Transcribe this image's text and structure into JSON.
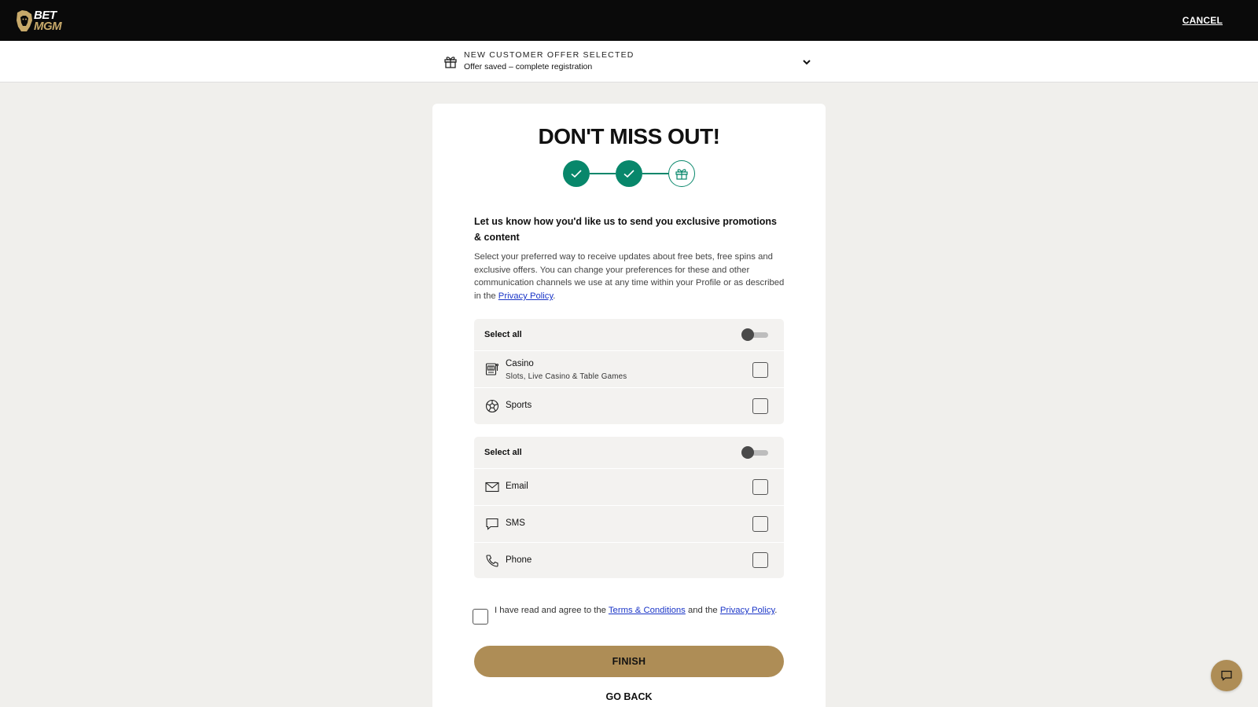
{
  "header": {
    "logo_line1": "BET",
    "logo_line2": "MGM",
    "cancel_label": "CANCEL"
  },
  "offer_bar": {
    "heading": "NEW CUSTOMER OFFER SELECTED",
    "subtext": "Offer saved – complete registration",
    "icon": "gift-icon",
    "expand_icon": "chevron-down-icon"
  },
  "card": {
    "title": "DON'T MISS OUT!",
    "stepper": {
      "steps": [
        {
          "state": "done",
          "icon": "check-icon"
        },
        {
          "state": "done",
          "icon": "check-icon"
        },
        {
          "state": "current",
          "icon": "gift-icon"
        }
      ],
      "active_color": "#08876b"
    },
    "lead": "Let us know how you'd like us to send you exclusive promotions & content",
    "description_before_link": "Select your preferred way to receive updates about free bets, free spins and exclusive offers. You can change your preferences for these and other communication channels we use at any time within your Profile or as described in the ",
    "description_link": "Privacy Policy",
    "description_after_link": ".",
    "products_group": {
      "select_all_label": "Select all",
      "select_all_on": false,
      "items": [
        {
          "label": "Casino",
          "sublabel": "Slots, Live Casino & Table Games",
          "icon": "slot-machine-icon",
          "checked": false
        },
        {
          "label": "Sports",
          "icon": "soccer-ball-icon",
          "checked": false
        }
      ]
    },
    "channels_group": {
      "select_all_label": "Select all",
      "select_all_on": false,
      "items": [
        {
          "label": "Email",
          "icon": "envelope-icon",
          "checked": false
        },
        {
          "label": "SMS",
          "icon": "message-icon",
          "checked": false
        },
        {
          "label": "Phone",
          "icon": "phone-icon",
          "checked": false
        }
      ]
    },
    "agreement": {
      "checked": false,
      "text_1": "I have read and agree to the ",
      "link_1": "Terms & Conditions",
      "text_2": " and the ",
      "link_2": "Privacy Policy",
      "text_3": "."
    },
    "finish_label": "FINISH",
    "go_back_label": "GO BACK"
  },
  "chat": {
    "icon": "chat-icon"
  },
  "colors": {
    "brand_gold": "#ae8d56",
    "success_green": "#08876b",
    "link_blue": "#1a35c7",
    "topbar": "#0a0a0a"
  }
}
